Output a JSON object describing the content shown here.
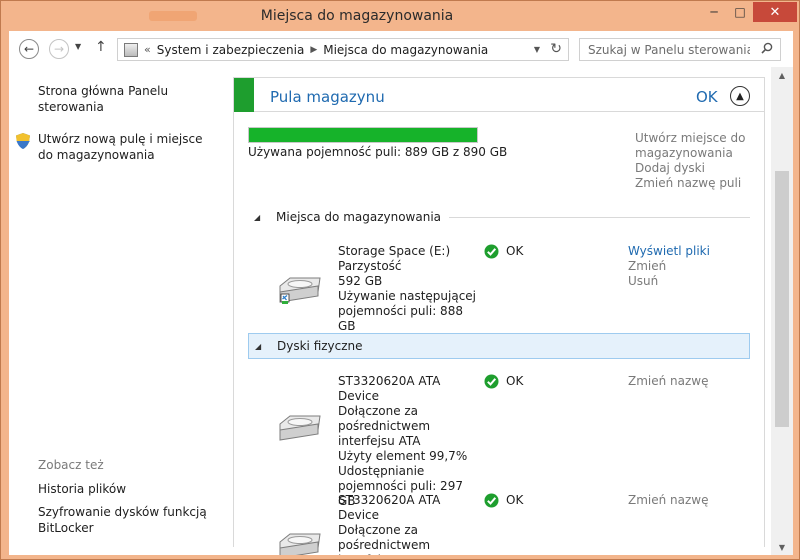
{
  "window": {
    "title": "Miejsca do magazynowania",
    "minimize": "─",
    "maximize": "□",
    "close": "✕"
  },
  "navbar": {
    "back": "←",
    "forward": "→",
    "recent": "▼",
    "up": "↑",
    "breadcrumb": [
      "System i zabezpieczenia",
      "Miejsca do magazynowania"
    ],
    "breadcrumb_prefix": "«",
    "breadcrumb_separator": "▶",
    "search_placeholder": "Szukaj w Panelu sterowania"
  },
  "sidebar": {
    "home": "Strona główna Panelu sterowania",
    "create": "Utwórz nową pulę i miejsce do magazynowania",
    "see_also": "Zobacz też",
    "history": "Historia plików",
    "bitlocker": "Szyfrowanie dysków funkcją BitLocker"
  },
  "pool": {
    "title": "Pula magazynu",
    "status": "OK",
    "used_fraction": 0.999,
    "used_text": "Używana pojemność puli: 889 GB z 890 GB",
    "actions": [
      "Utwórz miejsce do magazynowania",
      "Dodaj dyski",
      "Zmień nazwę puli"
    ]
  },
  "sections": {
    "spaces": "Miejsca do magazynowania",
    "disks": "Dyski fizyczne"
  },
  "space": {
    "name": "Storage Space (E:)",
    "resiliency": "Parzystość",
    "size": "592 GB",
    "usage": "Używanie następującej pojemności puli: 888 GB",
    "status": "OK",
    "actions": [
      "Wyświetl pliki",
      "Zmień",
      "Usuń"
    ]
  },
  "disks": [
    {
      "name": "ST3320620A ATA Device",
      "connection": "Dołączone za pośrednictwem interfejsu ATA",
      "used": "Użyty element 99,7%",
      "share": "Udostępnianie pojemności puli: 297 GB",
      "status": "OK",
      "action": "Zmień nazwę"
    },
    {
      "name": "ST3320620A ATA Device",
      "connection": "Dołączone za pośrednictwem interfejsu ATA",
      "status": "OK",
      "action": "Zmień nazwę"
    }
  ],
  "colors": {
    "accent_blue": "#1f6ab0",
    "pool_green": "#1e9e2e",
    "progress_green": "#16b32a",
    "title_bar": "#f3b58c",
    "close_red": "#c7493a"
  }
}
